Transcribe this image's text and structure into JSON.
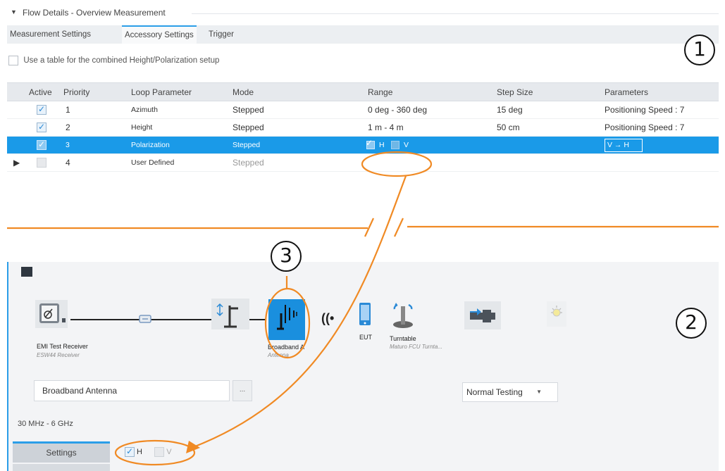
{
  "flow_details": {
    "title": "Flow Details  -  Overview Measurement"
  },
  "tabs": [
    {
      "label": "Measurement Settings",
      "active": false
    },
    {
      "label": "Accessory Settings",
      "active": true
    },
    {
      "label": "Trigger",
      "active": false
    }
  ],
  "table_option": {
    "label": "Use a table for the combined Height/Polarization setup",
    "checked": false
  },
  "loop_table": {
    "headers": [
      "Active",
      "Priority",
      "Loop Parameter",
      "Mode",
      "Range",
      "Step Size",
      "Parameters"
    ],
    "rows": [
      {
        "active": true,
        "priority": "1",
        "loop_parameter": "Azimuth",
        "mode": "Stepped",
        "range": "0 deg  -  360 deg",
        "step_size": "15 deg",
        "parameters": "Positioning Speed : 7"
      },
      {
        "active": true,
        "priority": "2",
        "loop_parameter": "Height",
        "mode": "Stepped",
        "range": "1 m  -  4 m",
        "step_size": "50 cm",
        "parameters": "Positioning Speed : 7"
      },
      {
        "active": true,
        "priority": "3",
        "loop_parameter": "Polarization",
        "mode": "Stepped",
        "range_h": "H",
        "range_v": "V",
        "step_size": "",
        "parameters": "V → H",
        "selected": true
      },
      {
        "active": false,
        "priority": "4",
        "loop_parameter": "User Defined",
        "mode": "Stepped",
        "range": "",
        "step_size": "",
        "parameters": ""
      }
    ]
  },
  "callouts": {
    "one": "1",
    "two": "2",
    "three": "3"
  },
  "test_setup": {
    "devices": [
      {
        "label": "EMI Test Receiver",
        "sub": "ESW44 Receiver",
        "icon": "receiver-icon"
      },
      {
        "label": "",
        "sub": "",
        "icon": "cable-connector-icon"
      },
      {
        "label": "",
        "sub": "",
        "icon": "antenna-mast-icon"
      },
      {
        "label": "Broadband A",
        "sub": "Antenna",
        "icon": "broadband-antenna-icon",
        "selected": true
      },
      {
        "label": "",
        "sub": "",
        "icon": "wireless-signal-icon"
      },
      {
        "label": "EUT",
        "sub": "",
        "icon": "eut-device-icon"
      },
      {
        "label": "Turntable",
        "sub": "Maturo FCU Turnta...",
        "icon": "turntable-icon"
      },
      {
        "label": "",
        "sub": "",
        "icon": "amplifier-icon"
      },
      {
        "label": "",
        "sub": "",
        "icon": "lamp-icon"
      }
    ],
    "antenna_field_value": "Broadband Antenna",
    "browse_label": "...",
    "mode_value": "Normal Testing",
    "frequency_range": "30 MHz - 6 GHz",
    "settings_tab": "Settings",
    "polarization": {
      "h_label": "H",
      "h_checked": true,
      "v_label": "V",
      "v_checked": false
    }
  },
  "colors": {
    "accent": "#2b9ee8",
    "selection": "#1a9ae8",
    "callout_orange": "#f08a24"
  }
}
